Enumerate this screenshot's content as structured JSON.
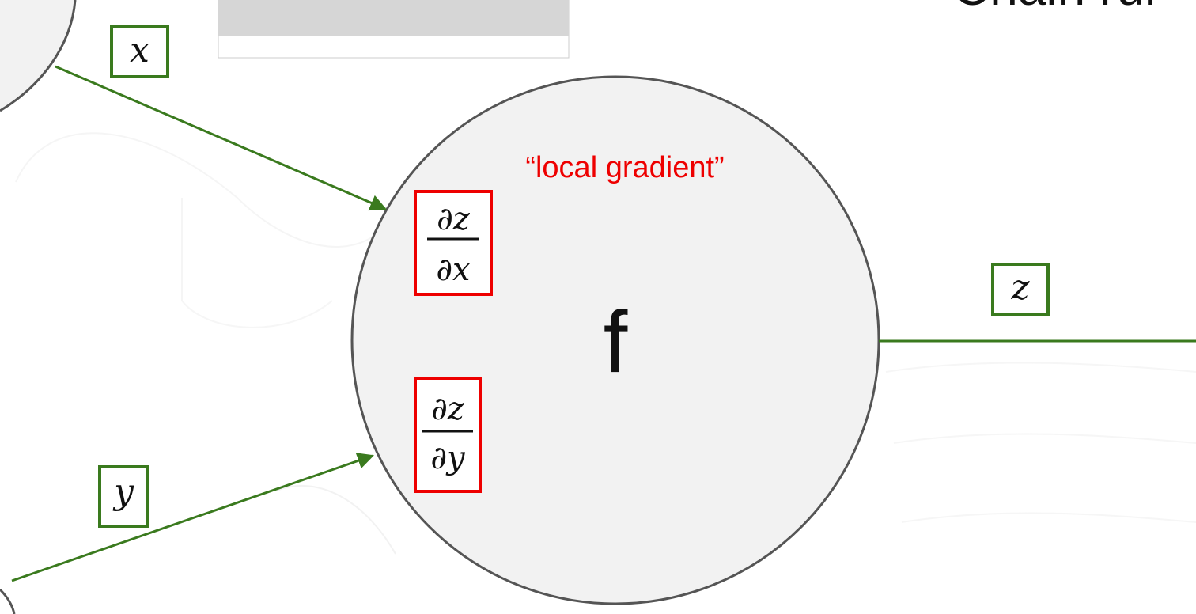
{
  "title_fragment": "Chain rul",
  "node": {
    "function_label": "f",
    "local_gradient_caption": "“local gradient”"
  },
  "inputs": [
    {
      "name": "x"
    },
    {
      "name": "y"
    }
  ],
  "output": {
    "name": "z"
  },
  "local_gradients": [
    {
      "numerator": "∂z",
      "denominator": "∂x"
    },
    {
      "numerator": "∂z",
      "denominator": "∂y"
    }
  ],
  "colors": {
    "edge_green": "#3a7a1e",
    "gradient_red": "#ee0000",
    "node_fill": "#f2f2f2",
    "node_stroke": "#555555"
  }
}
